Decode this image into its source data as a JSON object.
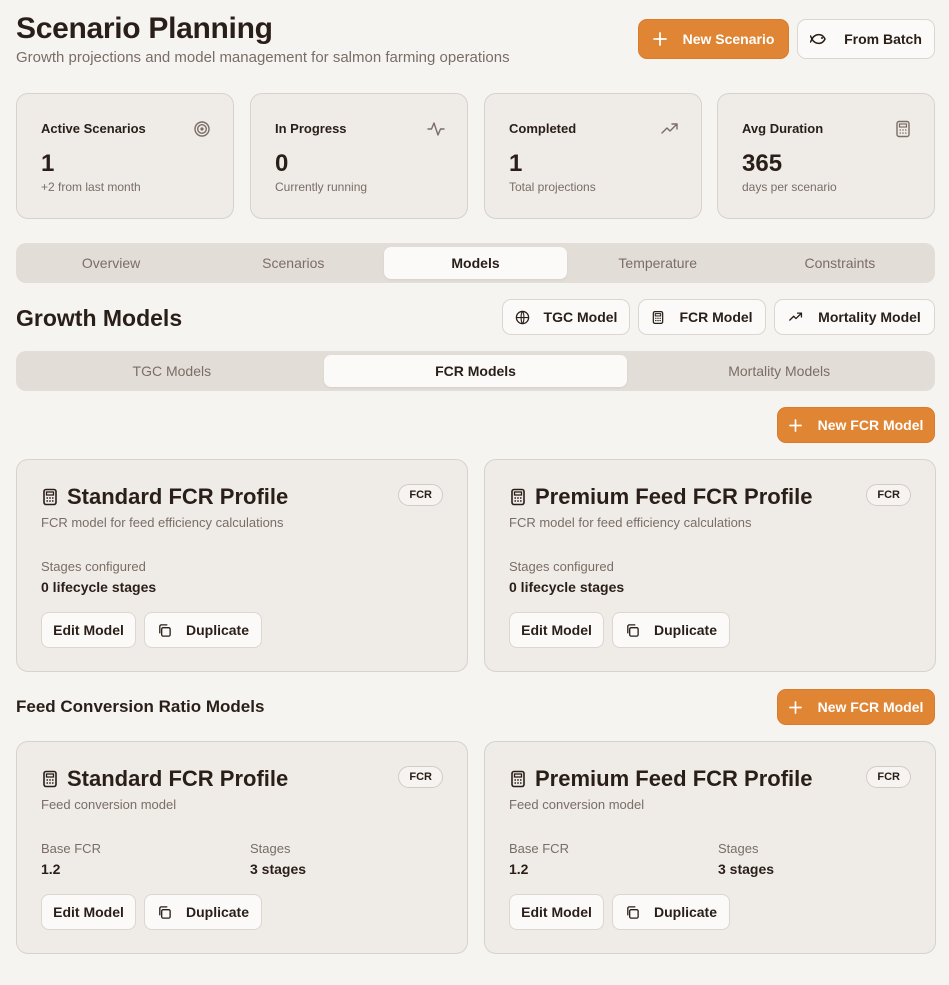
{
  "header": {
    "title": "Scenario Planning",
    "subtitle": "Growth projections and model management for salmon farming operations",
    "new_scenario_label": "New Scenario",
    "from_batch_label": "From Batch"
  },
  "stats": [
    {
      "label": "Active Scenarios",
      "value": "1",
      "note": "+2 from last month",
      "icon": "target-icon"
    },
    {
      "label": "In Progress",
      "value": "0",
      "note": "Currently running",
      "icon": "activity-icon"
    },
    {
      "label": "Completed",
      "value": "1",
      "note": "Total projections",
      "icon": "trending-up-icon"
    },
    {
      "label": "Avg Duration",
      "value": "365",
      "note": "days per scenario",
      "icon": "calculator-icon"
    }
  ],
  "main_tabs": [
    "Overview",
    "Scenarios",
    "Models",
    "Temperature",
    "Constraints"
  ],
  "main_tabs_active": "Models",
  "growth_models": {
    "title": "Growth Models",
    "tgc_button": "TGC Model",
    "fcr_button": "FCR Model",
    "mortality_button": "Mortality Model"
  },
  "model_tabs": [
    "TGC Models",
    "FCR Models",
    "Mortality Models"
  ],
  "model_tabs_active": "FCR Models",
  "new_fcr_label": "New FCR Model",
  "fcr_cards": [
    {
      "title": "Standard FCR Profile",
      "badge": "FCR",
      "desc": "FCR model for feed efficiency calculations",
      "stages_label": "Stages configured",
      "stages_value": "0 lifecycle stages",
      "edit": "Edit Model",
      "duplicate": "Duplicate"
    },
    {
      "title": "Premium Feed FCR Profile",
      "badge": "FCR",
      "desc": "FCR model for feed efficiency calculations",
      "stages_label": "Stages configured",
      "stages_value": "0 lifecycle stages",
      "edit": "Edit Model",
      "duplicate": "Duplicate"
    }
  ],
  "fcr_section": {
    "title": "Feed Conversion Ratio Models",
    "new_label": "New FCR Model"
  },
  "ratio_cards": [
    {
      "title": "Standard FCR Profile",
      "badge": "FCR",
      "desc": "Feed conversion model",
      "base_label": "Base FCR",
      "base_value": "1.2",
      "stages_label": "Stages",
      "stages_value": "3 stages",
      "edit": "Edit Model",
      "duplicate": "Duplicate"
    },
    {
      "title": "Premium Feed FCR Profile",
      "badge": "FCR",
      "desc": "Feed conversion model",
      "base_label": "Base FCR",
      "base_value": "1.2",
      "stages_label": "Stages",
      "stages_value": "3 stages",
      "edit": "Edit Model",
      "duplicate": "Duplicate"
    }
  ],
  "colors": {
    "accent": "#e08534",
    "background": "#f6f4f1",
    "card": "#efebe7",
    "text": "#2a1e18",
    "muted": "#7a6d66"
  }
}
